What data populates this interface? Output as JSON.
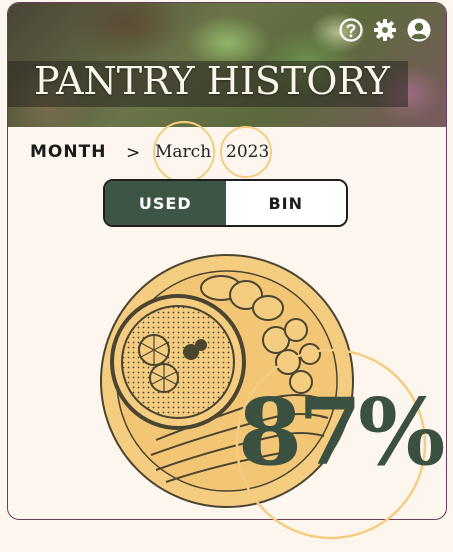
{
  "header": {
    "title": "PANTRY HISTORY",
    "icons": [
      "help-icon",
      "gear-icon",
      "profile-icon"
    ]
  },
  "breadcrumb": {
    "level_label": "MONTH",
    "separator": ">",
    "month": "March",
    "year": "2023"
  },
  "view_toggle": {
    "options": [
      "USED",
      "BIN"
    ],
    "selected": "USED"
  },
  "stats": {
    "used_percent": "87%"
  },
  "colors": {
    "accent_green": "#3c5545",
    "highlight_ring": "#f5cd80",
    "plate_fill": "#f5cd80",
    "card_border": "#6b3f55",
    "background": "#fdf6ee"
  }
}
